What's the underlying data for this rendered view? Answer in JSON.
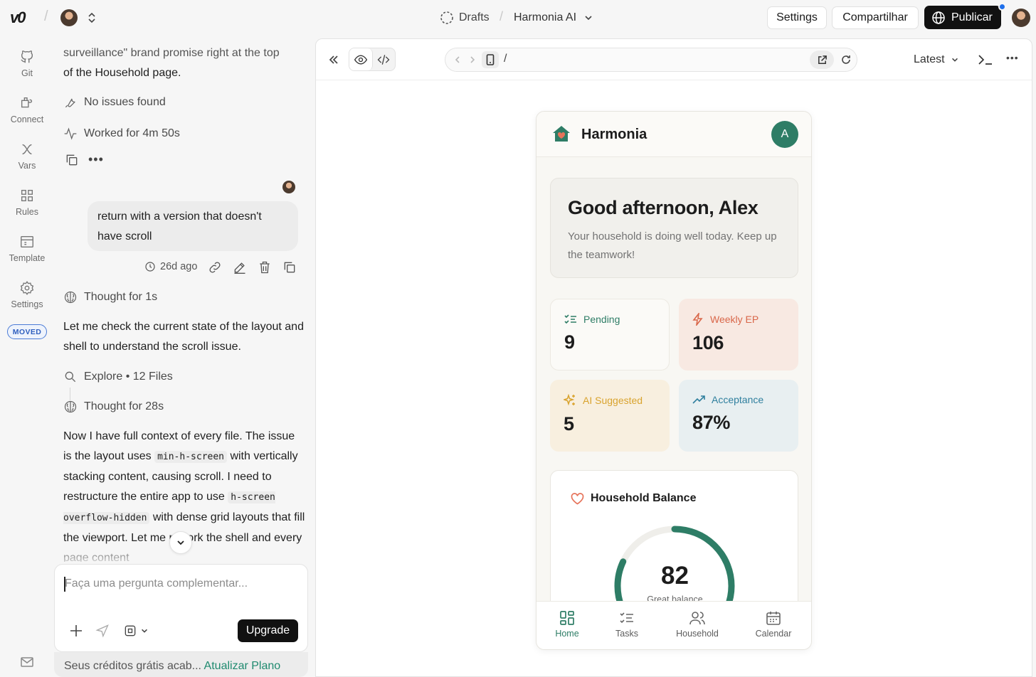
{
  "topbar": {
    "logo": "v0",
    "breadcrumb_drafts": "Drafts",
    "project_name": "Harmonia AI",
    "settings_label": "Settings",
    "share_label": "Compartilhar",
    "publish_label": "Publicar"
  },
  "rail": {
    "items": [
      {
        "label": "Git",
        "icon": "github-icon"
      },
      {
        "label": "Connect",
        "icon": "plug-icon"
      },
      {
        "label": "Vars",
        "icon": "variable-icon"
      },
      {
        "label": "Rules",
        "icon": "grid-icon"
      },
      {
        "label": "Template",
        "icon": "template-icon"
      },
      {
        "label": "Settings",
        "icon": "gear-icon"
      }
    ],
    "moved_badge": "MOVED"
  },
  "chat": {
    "prev_line1": "surveillance\" brand promise right at the top",
    "prev_line2": "of the Household page.",
    "no_issues": "No issues found",
    "worked_for": "Worked for 4m 50s",
    "user_message": "return with a version that doesn't have scroll",
    "message_age": "26d ago",
    "thought1": "Thought for 1s",
    "reply1": "Let me check the current state of the layout and shell to understand the scroll issue.",
    "explore": "Explore • 12 Files",
    "thought2": "Thought for 28s",
    "reply2_a": "Now I have full context of every file. The issue is the layout uses ",
    "reply2_code1": "min-h-screen",
    "reply2_b": " with vertically stacking content, causing scroll. I need to restructure the entire app to use ",
    "reply2_code2": "h-screen overflow-hidden",
    "reply2_c": " with dense grid layouts that fill the viewport. Let me rework the shell and every page content"
  },
  "composer": {
    "placeholder": "Faça uma pergunta complementar...",
    "upgrade_label": "Upgrade",
    "credits_text": "Seus créditos grátis acab...",
    "credits_link": "Atualizar Plano"
  },
  "preview": {
    "path": "/",
    "version_label": "Latest"
  },
  "app": {
    "brand": "Harmonia",
    "avatar_initial": "A",
    "greeting": "Good afternoon, Alex",
    "subtext": "Your household is doing well today. Keep up the teamwork!",
    "stats": [
      {
        "label": "Pending",
        "value": "9",
        "color": "#2e7d66",
        "bg": "#fbfaf7"
      },
      {
        "label": "Weekly EP",
        "value": "106",
        "color": "#d9674a",
        "bg": "#f8e9e2"
      },
      {
        "label": "AI Suggested",
        "value": "5",
        "color": "#d9a32e",
        "bg": "#f8efdf"
      },
      {
        "label": "Acceptance",
        "value": "87%",
        "color": "#2f7f9e",
        "bg": "#e8eff1"
      }
    ],
    "balance_title": "Household Balance",
    "balance_score": "82",
    "balance_score_fraction": 0.82,
    "balance_caption": "Great balance",
    "tabs": [
      {
        "label": "Home",
        "active": true
      },
      {
        "label": "Tasks",
        "active": false
      },
      {
        "label": "Household",
        "active": false
      },
      {
        "label": "Calendar",
        "active": false
      }
    ],
    "accent": "#2e7d66"
  }
}
